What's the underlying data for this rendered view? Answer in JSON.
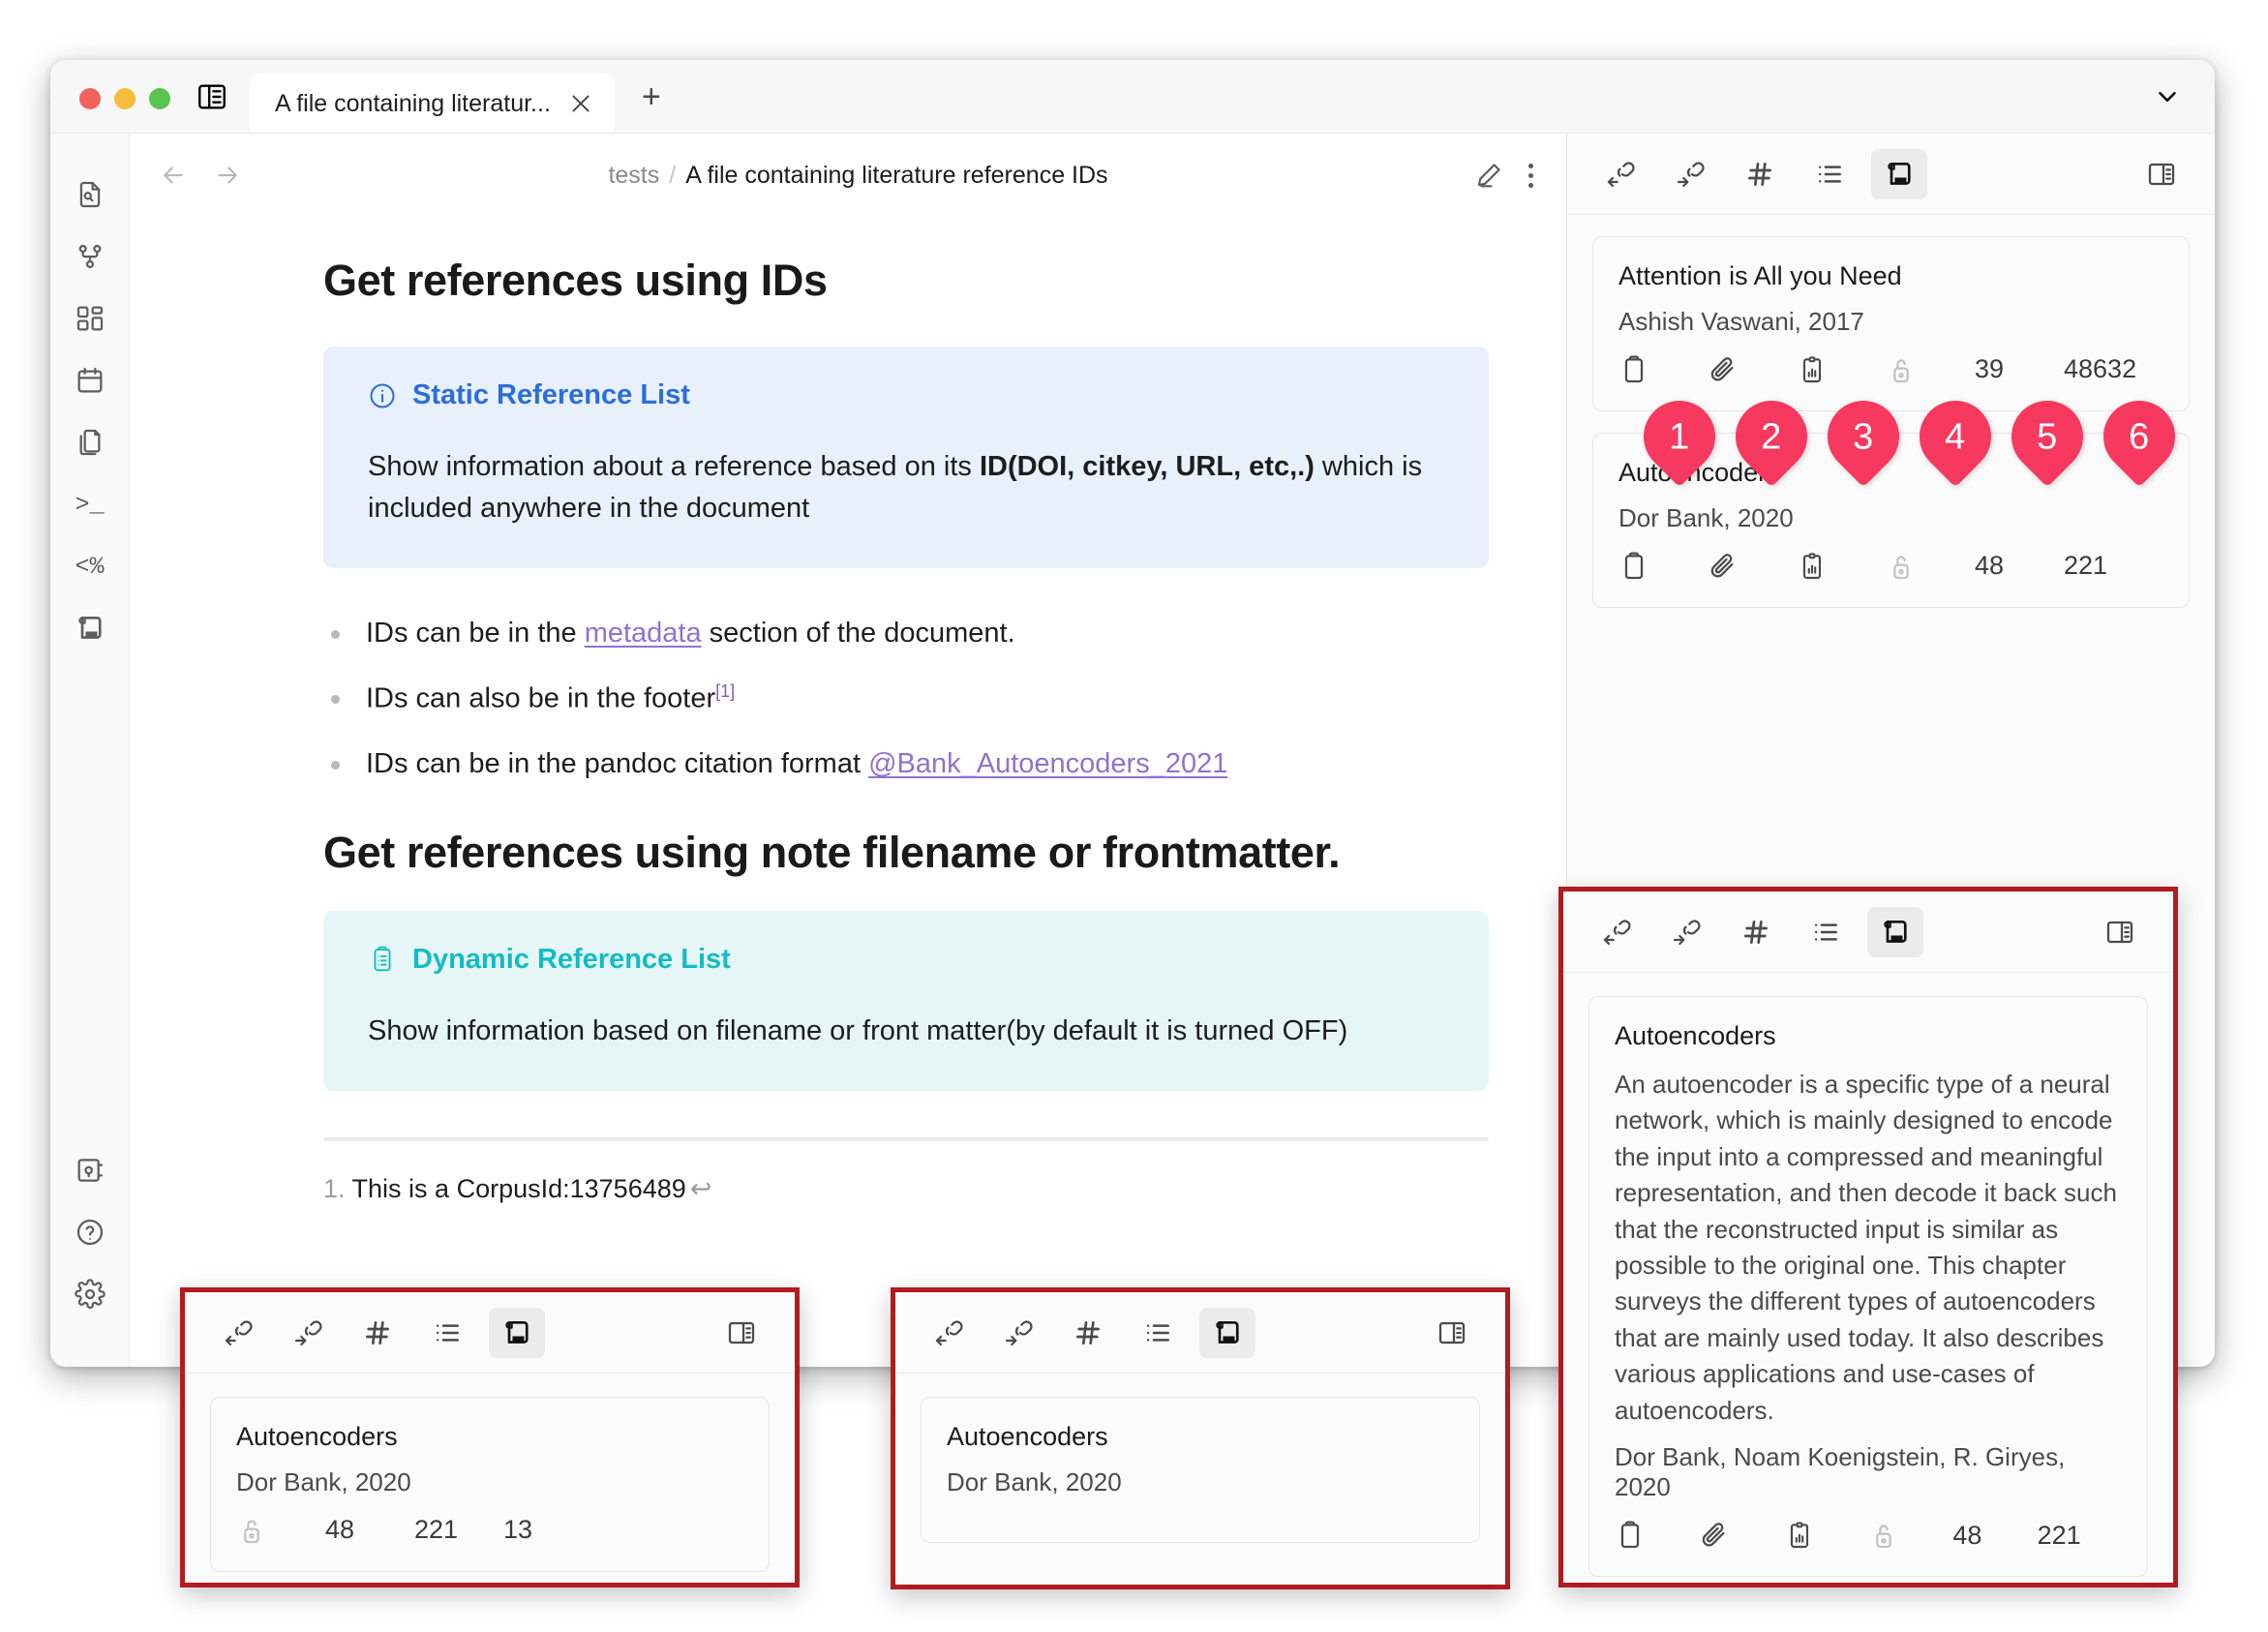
{
  "window": {
    "traffic_lights": [
      "close",
      "minimize",
      "zoom"
    ],
    "sidebar_toggle_icon": "sidebar-toggle-icon",
    "tab": {
      "title": "A file containing literatur...",
      "close_icon": "close-icon"
    },
    "new_tab_label": "+",
    "tab_overflow_icon": "chevron-down-icon"
  },
  "ribbon": {
    "items": [
      {
        "name": "file-search-icon",
        "label": ""
      },
      {
        "name": "graph-view-icon",
        "label": ""
      },
      {
        "name": "canvas-icon",
        "label": ""
      },
      {
        "name": "calendar-icon",
        "label": ""
      },
      {
        "name": "copy-files-icon",
        "label": ""
      },
      {
        "name": "terminal-icon",
        "label": ">_"
      },
      {
        "name": "templater-icon",
        "label": "<%"
      },
      {
        "name": "reference-scroll-icon",
        "label": ""
      }
    ],
    "bottom_items": [
      {
        "name": "vault-icon",
        "label": ""
      },
      {
        "name": "help-icon",
        "label": "?"
      },
      {
        "name": "settings-gear-icon",
        "label": ""
      }
    ]
  },
  "editor_header": {
    "back_icon": "arrow-left-icon",
    "forward_icon": "arrow-right-icon",
    "breadcrumb_parent": "tests",
    "breadcrumb_separator": "/",
    "breadcrumb_current": "A file containing literature reference IDs",
    "edit_icon": "pencil-icon",
    "more_icon": "more-vertical-icon"
  },
  "document": {
    "heading_1": "Get references using IDs",
    "callout_static": {
      "icon": "info-icon",
      "title": "Static Reference List",
      "body_pre": "Show information about a reference based on its ",
      "body_bold": "ID(DOI, citkey, URL, etc,.)",
      "body_post": " which is included anywhere in the document",
      "accent": "#2b6ed9",
      "background": "#e8f0fb"
    },
    "bullets": [
      {
        "pre": "IDs can be in the ",
        "link": "metadata",
        "post": " section of the document.",
        "sup": ""
      },
      {
        "pre": "IDs can also be in the footer",
        "link": "",
        "post": "",
        "sup": "[1]"
      },
      {
        "pre": "IDs can be in the pandoc citation format ",
        "link": "@Bank_Autoencoders_2021",
        "post": "",
        "sup": ""
      }
    ],
    "heading_2": "Get references using note filename or frontmatter.",
    "callout_dynamic": {
      "icon": "clipboard-list-icon",
      "title": "Dynamic Reference List",
      "body": "Show information based on filename or front matter(by default it is turned OFF)",
      "accent": "#12bcc4",
      "background": "#e6f6f6"
    },
    "footnote": {
      "number": "1.",
      "text": "This is a CorpusId:13756489",
      "back_icon": "↩"
    }
  },
  "reference_pane": {
    "toolbar": [
      {
        "name": "incoming-links-icon",
        "active": false
      },
      {
        "name": "outgoing-links-icon",
        "active": false
      },
      {
        "name": "tags-icon",
        "active": false
      },
      {
        "name": "outline-list-icon",
        "active": false
      },
      {
        "name": "reference-scroll-icon",
        "active": true
      }
    ],
    "toolbar_right": {
      "name": "split-pane-icon",
      "active": false
    },
    "cards": [
      {
        "title": "Attention is All you Need",
        "authors": "Ashish Vaswani, 2017",
        "icons": [
          "clipboard-icon",
          "paperclip-icon",
          "chart-clipboard-icon",
          "open-access-icon"
        ],
        "citation_count": "39",
        "reference_count": "48632"
      },
      {
        "title": "Autoencoders",
        "authors": "Dor Bank, 2020",
        "icons": [
          "clipboard-icon",
          "paperclip-icon",
          "chart-clipboard-icon",
          "open-access-icon"
        ],
        "citation_count": "48",
        "reference_count": "221"
      }
    ]
  },
  "pins": [
    {
      "number": "1",
      "target": "clipboard-icon"
    },
    {
      "number": "2",
      "target": "paperclip-icon"
    },
    {
      "number": "3",
      "target": "chart-clipboard-icon"
    },
    {
      "number": "4",
      "target": "open-access-icon"
    },
    {
      "number": "5",
      "target": "citation-count"
    },
    {
      "number": "6",
      "target": "reference-count"
    }
  ],
  "float_panels": {
    "left": {
      "toolbar": [
        {
          "name": "incoming-links-icon",
          "active": false
        },
        {
          "name": "outgoing-links-icon",
          "active": false
        },
        {
          "name": "tags-icon",
          "active": false
        },
        {
          "name": "outline-list-icon",
          "active": false
        },
        {
          "name": "reference-scroll-icon",
          "active": true
        }
      ],
      "toolbar_right": {
        "name": "split-pane-icon",
        "active": false
      },
      "card": {
        "title": "Autoencoders",
        "authors": "Dor Bank, 2020",
        "icons": [
          "open-access-icon"
        ],
        "num_1": "48",
        "num_2": "221",
        "num_3": "13"
      }
    },
    "mid": {
      "toolbar": [
        {
          "name": "incoming-links-icon",
          "active": false
        },
        {
          "name": "outgoing-links-icon",
          "active": false
        },
        {
          "name": "tags-icon",
          "active": false
        },
        {
          "name": "outline-list-icon",
          "active": false
        },
        {
          "name": "reference-scroll-icon",
          "active": true
        }
      ],
      "toolbar_right": {
        "name": "split-pane-icon",
        "active": false
      },
      "card": {
        "title": "Autoencoders",
        "authors": "Dor Bank, 2020"
      }
    },
    "right": {
      "toolbar": [
        {
          "name": "incoming-links-icon",
          "active": false
        },
        {
          "name": "outgoing-links-icon",
          "active": false
        },
        {
          "name": "tags-icon",
          "active": false
        },
        {
          "name": "outline-list-icon",
          "active": false
        },
        {
          "name": "reference-scroll-icon",
          "active": true
        }
      ],
      "toolbar_right": {
        "name": "split-pane-icon",
        "active": false
      },
      "card": {
        "title": "Autoencoders",
        "abstract": "An autoencoder is a specific type of a neural network, which is mainly designed to encode the input into a compressed and meaningful representation, and then decode it back such that the reconstructed input is similar as possible to the original one. This chapter surveys the different types of autoencoders that are mainly used today. It also describes various applications and use-cases of autoencoders.",
        "authors": "Dor Bank, Noam Koenigstein, R. Giryes, 2020",
        "icons": [
          "clipboard-icon",
          "paperclip-icon",
          "chart-clipboard-icon",
          "open-access-icon"
        ],
        "num_1": "48",
        "num_2": "221"
      }
    }
  },
  "colors": {
    "pin": "#f7385f",
    "annotation_border": "#b01c20",
    "info_accent": "#2b6ed9",
    "tip_accent": "#12bcc4",
    "link": "#8f72cf"
  }
}
